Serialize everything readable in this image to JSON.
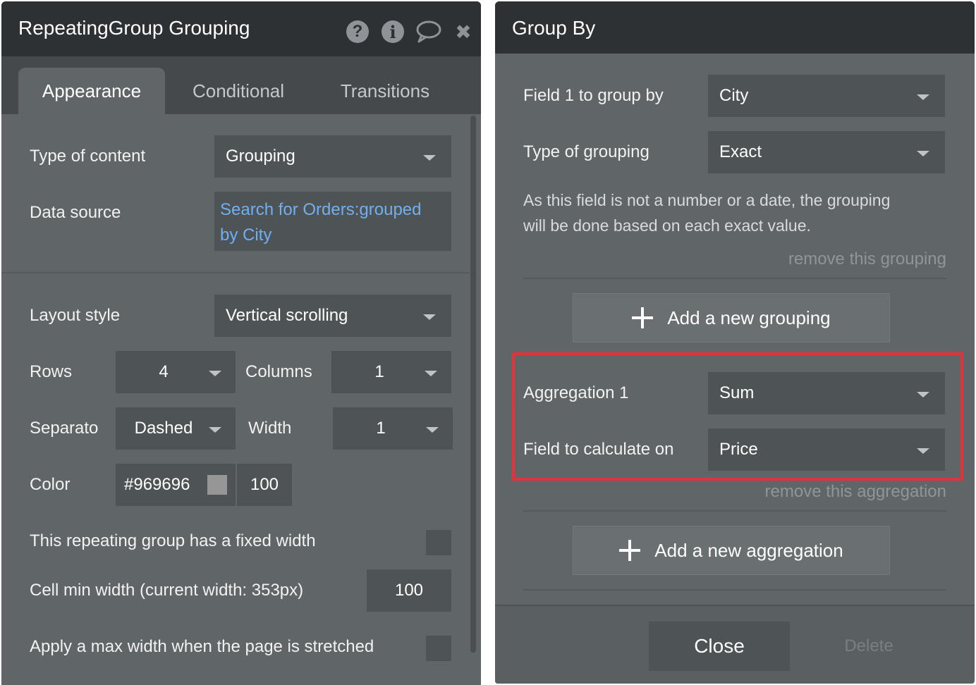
{
  "left_panel": {
    "title": "RepeatingGroup Grouping",
    "icons": [
      "help-icon",
      "info-icon",
      "comment-icon",
      "close-icon"
    ],
    "icon_glyphs": {
      "help": "?",
      "info": "i",
      "close": "✖"
    },
    "tabs": [
      {
        "label": "Appearance",
        "active": true
      },
      {
        "label": "Conditional",
        "active": false
      },
      {
        "label": "Transitions",
        "active": false
      }
    ],
    "type_of_content": {
      "label": "Type of content",
      "value": "Grouping"
    },
    "data_source": {
      "label": "Data source",
      "value_line1": "Search for Orders:grouped",
      "value_line2": "by City"
    },
    "layout_style": {
      "label": "Layout style",
      "value": "Vertical scrolling"
    },
    "rows": {
      "label": "Rows",
      "value": "4"
    },
    "columns": {
      "label": "Columns",
      "value": "1"
    },
    "separator": {
      "label": "Separato",
      "value": "Dashed"
    },
    "width": {
      "label": "Width",
      "value": "1"
    },
    "color": {
      "label": "Color",
      "value": "#969696",
      "swatch": "#969696",
      "opacity": "100"
    },
    "fixed_width": {
      "label": "This repeating group has a fixed width",
      "checked": false
    },
    "cell_min_width": {
      "label": "Cell min width (current width: 353px)",
      "value": "100"
    },
    "max_width": {
      "label": "Apply a max width when the page is stretched",
      "checked": false
    }
  },
  "right_panel": {
    "title": "Group By",
    "field1": {
      "label": "Field 1 to group by",
      "value": "City"
    },
    "type_of_grouping": {
      "label": "Type of grouping",
      "value": "Exact"
    },
    "grouping_help_line1": "As this field is not a number or a date, the grouping",
    "grouping_help_line2": "will be done based on each exact value.",
    "remove_grouping": "remove this grouping",
    "add_grouping": "Add a new grouping",
    "aggregation1": {
      "label": "Aggregation 1",
      "value": "Sum"
    },
    "field_calc": {
      "label": "Field to calculate on",
      "value": "Price"
    },
    "remove_aggregation": "remove this aggregation",
    "add_aggregation": "Add a new aggregation",
    "close_label": "Close",
    "delete_label": "Delete"
  },
  "colors": {
    "panel_bg": "#606568",
    "titlebar_bg": "#2d3134",
    "input_bg": "#4e5356",
    "link_blue": "#6eb0f2",
    "highlight_red": "#e0343a"
  }
}
